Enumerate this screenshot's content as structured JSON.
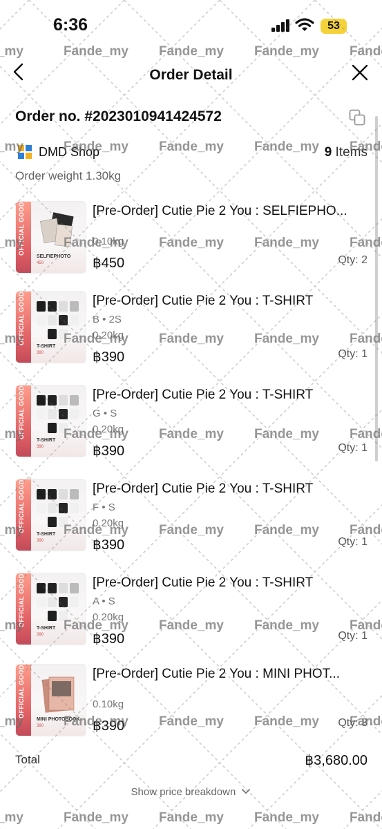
{
  "status_bar": {
    "time": "6:36",
    "battery": "53"
  },
  "nav": {
    "title": "Order Detail"
  },
  "order": {
    "number_label": "Order no. #2023010941424572",
    "shop_name": "DMD Shop",
    "item_count": "9",
    "item_word": "Items",
    "weight_label": "Order weight 1.30kg"
  },
  "items": [
    {
      "title": "[Pre-Order] Cutie Pie 2 You : SELFIEPHO...",
      "variant": "",
      "weight": "0.10kg",
      "price": "฿450",
      "qty": "Qty: 2",
      "thumb_caption": "SELFIEPHOTO",
      "thumb_price": "450"
    },
    {
      "title": "[Pre-Order] Cutie Pie 2 You : T-SHIRT",
      "variant": "B • 2S",
      "weight": "0.20kg",
      "price": "฿390",
      "qty": "Qty: 1",
      "thumb_caption": "T-SHIRT",
      "thumb_price": "390"
    },
    {
      "title": "[Pre-Order] Cutie Pie 2 You : T-SHIRT",
      "variant": "G • S",
      "weight": "0.20kg",
      "price": "฿390",
      "qty": "Qty: 1",
      "thumb_caption": "T-SHIRT",
      "thumb_price": "390"
    },
    {
      "title": "[Pre-Order] Cutie Pie 2 You : T-SHIRT",
      "variant": "F • S",
      "weight": "0.20kg",
      "price": "฿390",
      "qty": "Qty: 1",
      "thumb_caption": "T-SHIRT",
      "thumb_price": "390"
    },
    {
      "title": "[Pre-Order] Cutie Pie 2 You : T-SHIRT",
      "variant": "A • S",
      "weight": "0.20kg",
      "price": "฿390",
      "qty": "Qty: 1",
      "thumb_caption": "T-SHIRT",
      "thumb_price": "390"
    },
    {
      "title": "[Pre-Order] Cutie Pie 2 You : MINI PHOT...",
      "variant": "",
      "weight": "0.10kg",
      "price": "฿390",
      "qty": "Qty: 3",
      "thumb_caption": "MINI PHOTOBOOK",
      "thumb_price": "390"
    }
  ],
  "thumb_band_text": "OFFICIAL GOODS",
  "total": {
    "label": "Total",
    "value": "฿3,680.00"
  },
  "breakdown_label": "Show price breakdown",
  "watermark": "Fande_my",
  "icons": [
    "signal-icon",
    "wifi-icon",
    "back-arrow-icon",
    "close-icon",
    "copy-icon",
    "shop-logo-icon",
    "chevron-down-icon"
  ],
  "colors": {
    "battery": "#f6d23a",
    "thumb_band": "#e05e63",
    "watermark": "#6b6b6b"
  }
}
